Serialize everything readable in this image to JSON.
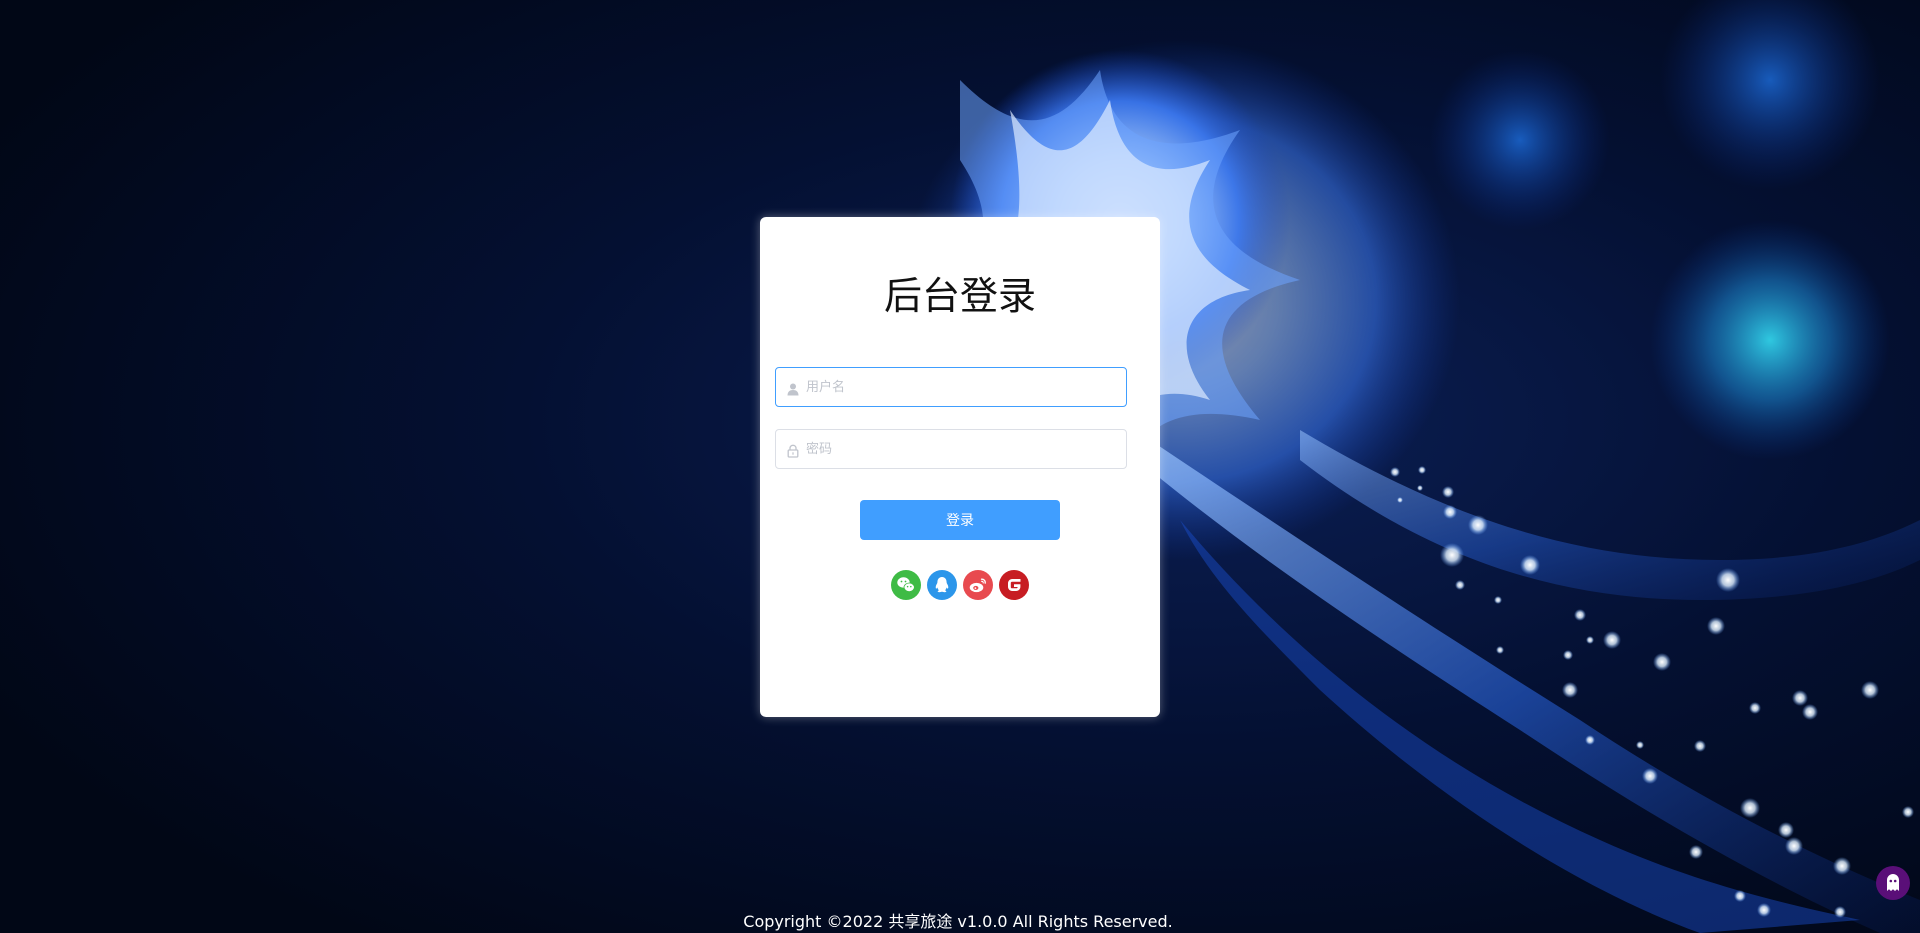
{
  "login": {
    "title": "后台登录",
    "username_placeholder": "用户名",
    "password_placeholder": "密码",
    "submit_label": "登录",
    "social_icons": [
      "wechat-icon",
      "qq-icon",
      "weibo-icon",
      "gitee-icon"
    ]
  },
  "footer": {
    "copyright": "Copyright ©2022 共享旅途 v1.0.0 All Rights Reserved."
  },
  "colors": {
    "primary": "#409eff",
    "wechat": "#3fbb45",
    "qq": "#2c96ea",
    "weibo": "#e84a4f",
    "gitee": "#c71d23",
    "background": "#010716"
  }
}
